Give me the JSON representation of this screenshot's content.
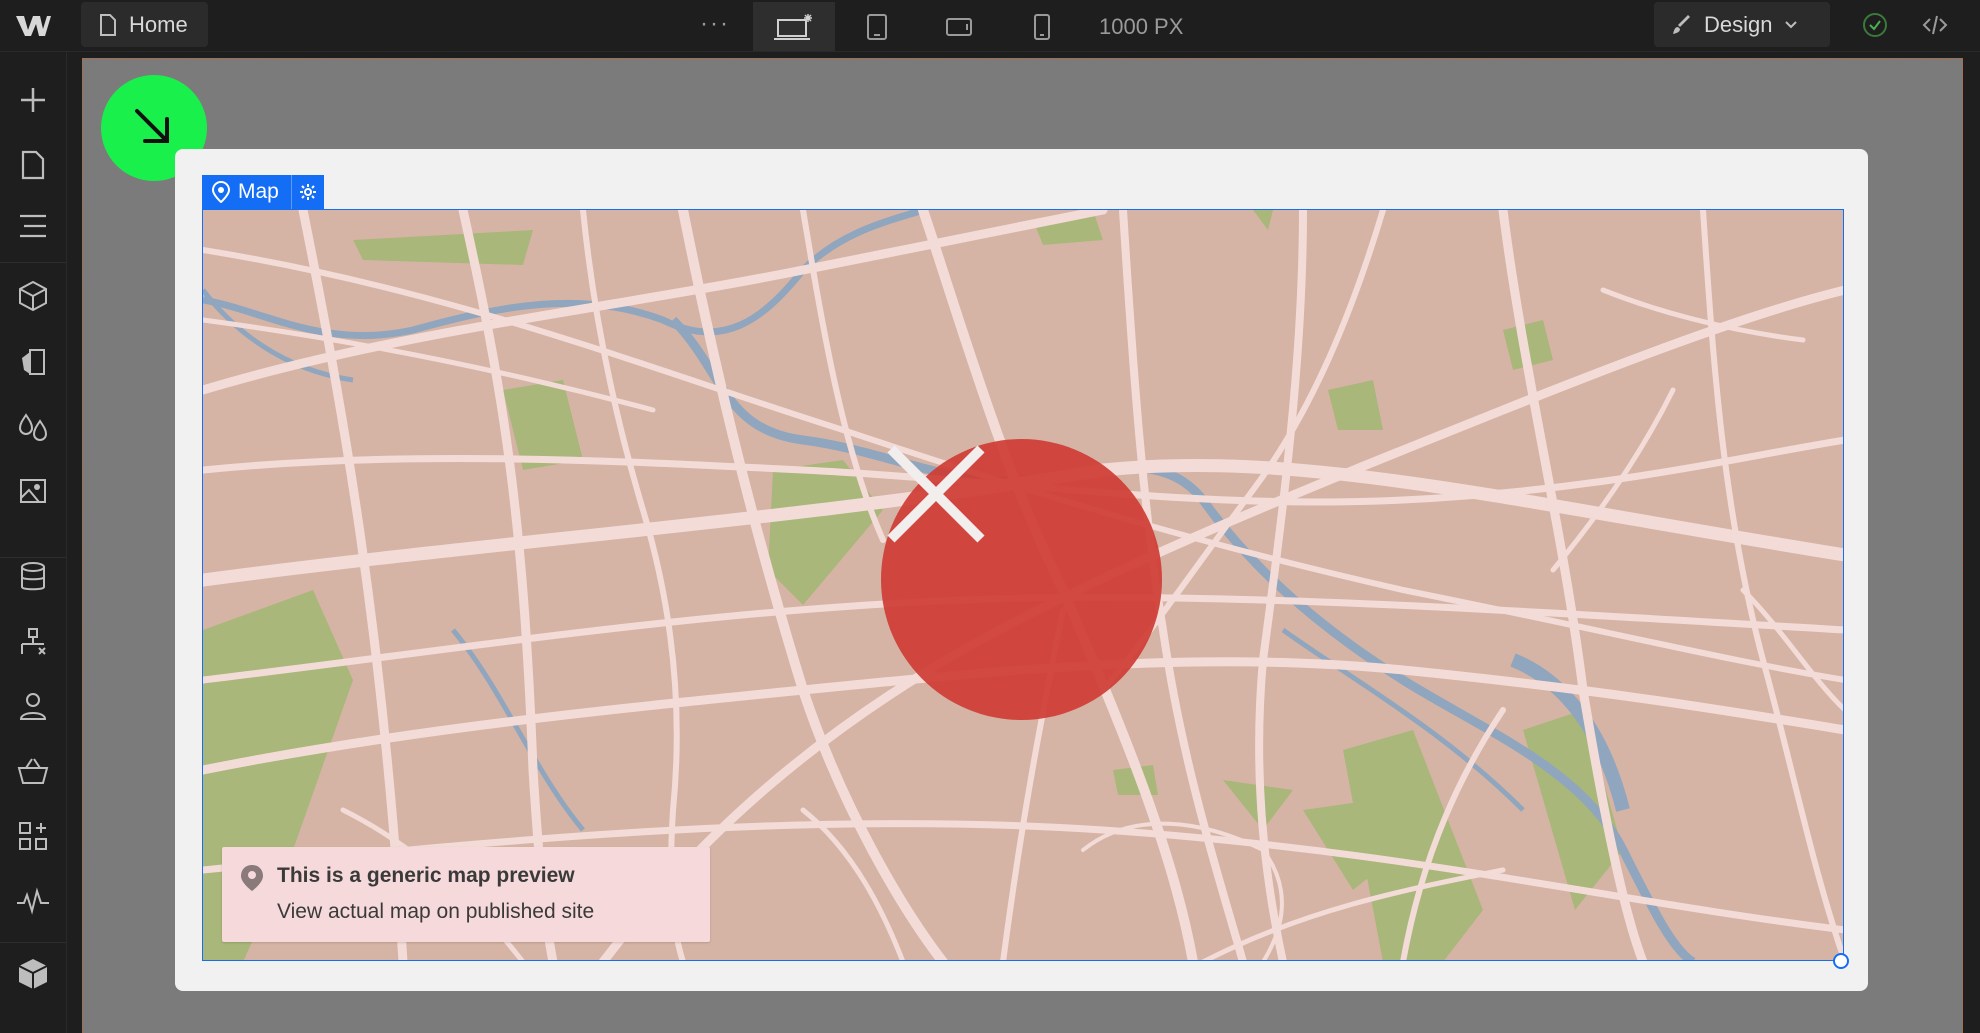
{
  "topbar": {
    "page_label": "Home",
    "more_label": "···",
    "width_readout": "1000 PX",
    "mode_label": "Design",
    "breakpoints": [
      "desktop-base-icon",
      "tablet-icon",
      "mobile-landscape-icon",
      "mobile-portrait-icon"
    ]
  },
  "leftrail": {
    "items": [
      "add-icon",
      "pages-icon",
      "navigator-icon",
      "components-icon",
      "styles-icon",
      "variables-icon",
      "assets-icon",
      "cms-icon",
      "logic-icon",
      "users-icon",
      "ecommerce-icon",
      "apps-icon",
      "audit-icon",
      "packages-icon"
    ]
  },
  "map_element": {
    "tag_label": "Map",
    "notice_title": "This is a generic map preview",
    "notice_subtitle": "View actual map on published site"
  },
  "colors": {
    "accent": "#146ef5",
    "fab": "#19f04c",
    "error": "#cf3c34",
    "map_land": "#d6b4a5",
    "map_road": "#f3dcd8",
    "map_water": "#8fa6be",
    "map_park": "#a9b77a"
  }
}
